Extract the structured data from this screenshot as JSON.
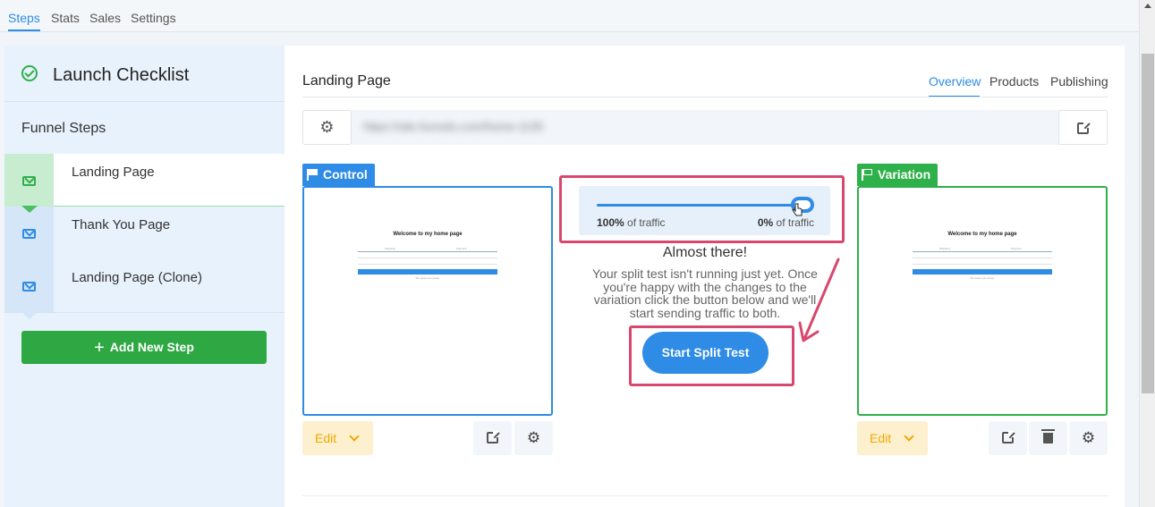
{
  "top_tabs": {
    "steps": "Steps",
    "stats": "Stats",
    "sales": "Sales",
    "settings": "Settings"
  },
  "sidebar": {
    "checklist_title": "Launch Checklist",
    "funnel_steps_label": "Funnel Steps",
    "steps": [
      {
        "label": "Landing Page",
        "active": true
      },
      {
        "label": "Thank You Page",
        "active": false
      },
      {
        "label": "Landing Page (Clone)",
        "active": false
      }
    ],
    "add_step_label": "Add New Step"
  },
  "main": {
    "page_title": "Landing Page",
    "tabs": {
      "overview": "Overview",
      "products": "Products",
      "publishing": "Publishing"
    },
    "url": "https://site.funnels.com/home-1135"
  },
  "control": {
    "tag": "Control",
    "edit_label": "Edit",
    "preview": {
      "title": "Welcome to my home page",
      "label_a": "Shipping",
      "label_b": "Payment",
      "button": "Go to Step 2",
      "footnote": "We respect your privacy"
    }
  },
  "variation": {
    "tag": "Variation",
    "edit_label": "Edit",
    "preview": {
      "title": "Welcome to my home page",
      "label_a": "Shipping",
      "label_b": "Payment",
      "button": "Go to Step 2",
      "footnote": "We respect your privacy"
    }
  },
  "split": {
    "control_pct": "100%",
    "variation_pct": "0%",
    "traffic_suffix": " of traffic",
    "heading": "Almost there!",
    "message": "Your split test isn't running just yet. Once you're happy with the changes to the variation click the button below and we'll start sending traffic to both.",
    "button": "Start Split Test"
  },
  "colors": {
    "primary": "#2e8be6",
    "success": "#2eb04a",
    "highlight": "#d8486e",
    "edit": "#f0a800"
  }
}
